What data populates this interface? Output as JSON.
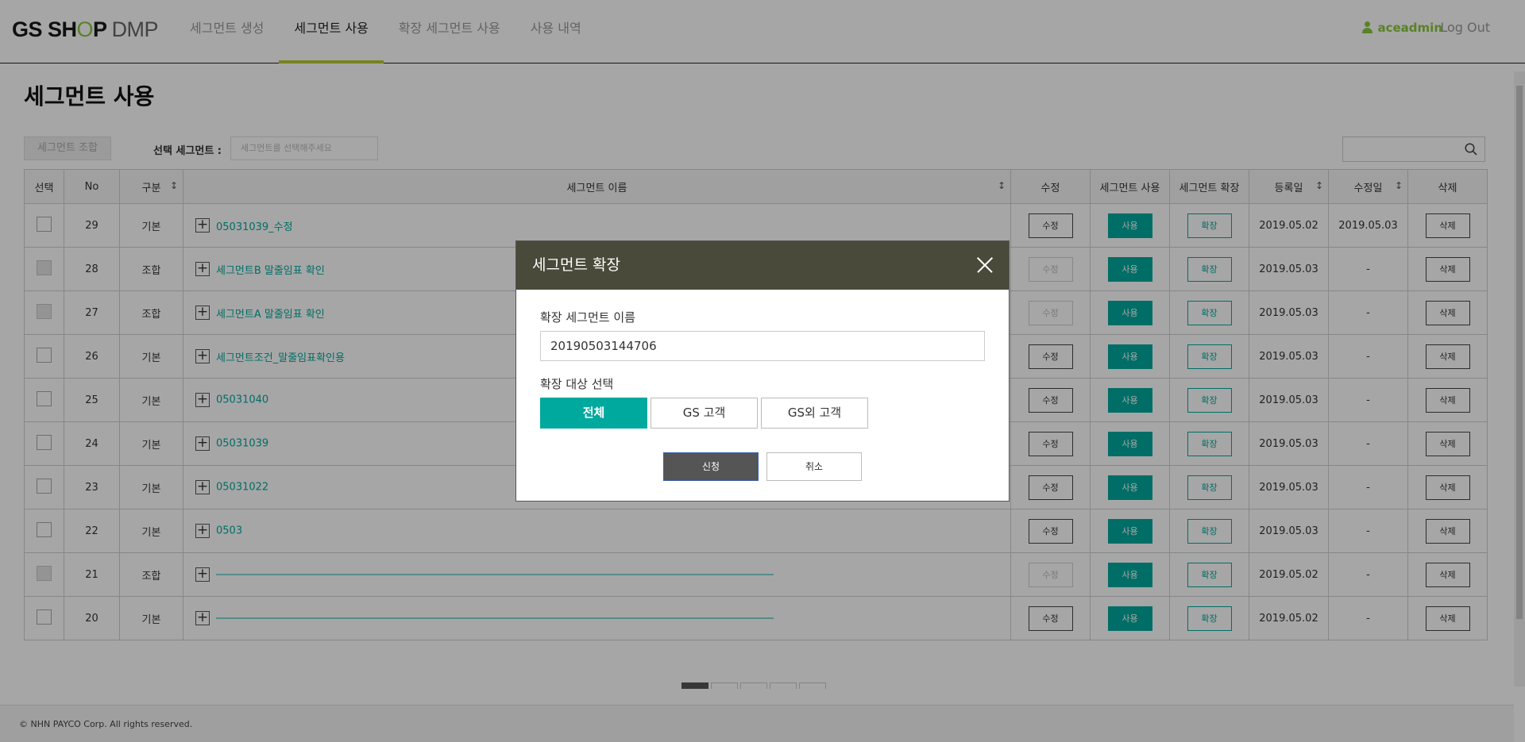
{
  "header": {
    "logo": {
      "part1": "GS SH",
      "o": "O",
      "part2": "P",
      "suffix": "DMP"
    },
    "nav": [
      {
        "label": "세그먼트 생성"
      },
      {
        "label": "세그먼트 사용",
        "active": true
      },
      {
        "label": "확장 세그먼트 사용"
      },
      {
        "label": "사용 내역"
      }
    ],
    "username": "aceadmin",
    "logout": "Log Out"
  },
  "page": {
    "title": "세그먼트 사용",
    "combine_button": "세그먼트 조합",
    "selected_label": "선택 세그먼트 :",
    "selected_placeholder": "세그먼트를 선택해주세요",
    "search_value": ""
  },
  "table": {
    "columns": [
      "선택",
      "No",
      "구분",
      "세그먼트 이름",
      "수정",
      "세그먼트 사용",
      "세그먼트 확장",
      "등록일",
      "수정일",
      "삭제"
    ],
    "rows": [
      {
        "no": "29",
        "type": "기본",
        "name": "05031039_수정",
        "edit": "수정",
        "use": "사용",
        "extend": "확장",
        "registered": "2019.05.02",
        "modified": "2019.05.03",
        "delete": "삭제",
        "disabled": false
      },
      {
        "no": "28",
        "type": "조합",
        "name": "세그먼트B 말줄임표 확인",
        "edit": "수정",
        "use": "사용",
        "extend": "확장",
        "registered": "2019.05.03",
        "modified": "-",
        "delete": "삭제",
        "disabled": true
      },
      {
        "no": "27",
        "type": "조합",
        "name": "세그먼트A 말줄임표 확인",
        "edit": "수정",
        "use": "사용",
        "extend": "확장",
        "registered": "2019.05.03",
        "modified": "-",
        "delete": "삭제",
        "disabled": true
      },
      {
        "no": "26",
        "type": "기본",
        "name": "세그먼트조건_말줄임표확인용",
        "edit": "수정",
        "use": "사용",
        "extend": "확장",
        "registered": "2019.05.03",
        "modified": "-",
        "delete": "삭제",
        "disabled": false
      },
      {
        "no": "25",
        "type": "기본",
        "name": "05031040",
        "edit": "수정",
        "use": "사용",
        "extend": "확장",
        "registered": "2019.05.03",
        "modified": "-",
        "delete": "삭제",
        "disabled": false
      },
      {
        "no": "24",
        "type": "기본",
        "name": "05031039",
        "edit": "수정",
        "use": "사용",
        "extend": "확장",
        "registered": "2019.05.03",
        "modified": "-",
        "delete": "삭제",
        "disabled": false
      },
      {
        "no": "23",
        "type": "기본",
        "name": "05031022",
        "edit": "수정",
        "use": "사용",
        "extend": "확장",
        "registered": "2019.05.03",
        "modified": "-",
        "delete": "삭제",
        "disabled": false
      },
      {
        "no": "22",
        "type": "기본",
        "name": "0503",
        "edit": "수정",
        "use": "사용",
        "extend": "확장",
        "registered": "2019.05.03",
        "modified": "-",
        "delete": "삭제",
        "disabled": false
      },
      {
        "no": "21",
        "type": "조합",
        "name": "――――――――――――――――――――――――――――――――――――――――――――――――――――――",
        "edit": "수정",
        "use": "사용",
        "extend": "확장",
        "registered": "2019.05.02",
        "modified": "-",
        "delete": "삭제",
        "disabled": true
      },
      {
        "no": "20",
        "type": "기본",
        "name": "――――――――――――――――――――――――――――――――――――――――――――――――――――――",
        "edit": "수정",
        "use": "사용",
        "extend": "확장",
        "registered": "2019.05.02",
        "modified": "-",
        "delete": "삭제",
        "disabled": false
      }
    ]
  },
  "footer": {
    "copyright": "© NHN PAYCO Corp. All rights reserved."
  },
  "modal": {
    "title": "세그먼트 확장",
    "name_label": "확장 세그먼트 이름",
    "name_value": "20190503144706",
    "target_label": "확장 대상 선택",
    "options": [
      "전체",
      "GS 고객",
      "GS외 고객"
    ],
    "selected_option": "전체",
    "apply_button": "신청",
    "cancel_button": "취소"
  },
  "colors": {
    "accent": "#00a99d",
    "nav_underline": "#b8c832",
    "user": "#8cc63f",
    "modal_header": "#4a4a3a"
  }
}
